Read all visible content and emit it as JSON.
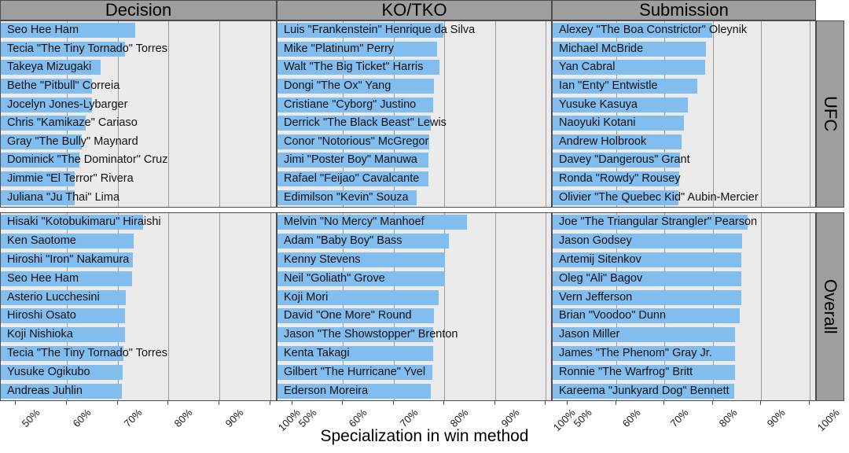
{
  "axis_title": "Specialization in win method",
  "colors": {
    "bar": "#82bdef",
    "panel_bg": "#ebebeb",
    "strip_bg": "#9e9e9e",
    "gridline": "#9a9a9a",
    "border": "#4d4d4d"
  },
  "chart_data": {
    "type": "bar",
    "title": "",
    "xlabel": "Specialization in win method",
    "ylabel": "",
    "xlim": [
      50,
      100
    ],
    "xticks": [
      50,
      60,
      70,
      80,
      90,
      100
    ],
    "xticklabels": [
      "50%",
      "60%",
      "70%",
      "80%",
      "90%",
      "100%"
    ],
    "grid": true,
    "orientation": "horizontal",
    "col_facets": [
      "Decision",
      "KO/TKO",
      "Submission"
    ],
    "row_facets": [
      "UFC",
      "Overall"
    ],
    "panels": [
      {
        "col": "Decision",
        "row": "UFC",
        "categories": [
          "Seo Hee Ham",
          "Tecia \"The Tiny Tornado\" Torres",
          "Takeya Mizugaki",
          "Bethe \"Pitbull\" Correia",
          "Jocelyn Jones-Lybarger",
          "Chris \"Kamikaze\" Cariaso",
          "Gray \"The Bully\" Maynard",
          "Dominick \"The Dominator\" Cruz",
          "Jimmie \"El Terror\" Rivera",
          "Juliana \"Ju Thai\" Lima"
        ],
        "values": [
          73.4,
          71.5,
          66.7,
          65.0,
          65.0,
          63.8,
          63.0,
          62.5,
          61.5,
          61.5
        ]
      },
      {
        "col": "KO/TKO",
        "row": "UFC",
        "categories": [
          "Luis \"Frankenstein\" Henrique da Silva",
          "Mike \"Platinum\" Perry",
          "Walt \"The Big Ticket\" Harris",
          "Dongi \"The Ox\" Yang",
          "Cristiane \"Cyborg\" Justino",
          "Derrick \"The Black Beast\" Lewis",
          "Conor \"Notorious\" McGregor",
          "Jimi \"Poster Boy\" Manuwa",
          "Rafael \"Feijao\" Cavalcante",
          "Edimilson \"Kevin\" Souza"
        ],
        "values": [
          79.8,
          78.5,
          79.0,
          78.0,
          77.8,
          77.3,
          77.0,
          76.8,
          76.8,
          74.5
        ]
      },
      {
        "col": "Submission",
        "row": "UFC",
        "categories": [
          "Alexey \"The Boa Constrictor\" Oleynik",
          "Michael McBride",
          "Yan Cabral",
          "Ian \"Enty\" Entwistle",
          "Yusuke Kasuya",
          "Naoyuki Kotani",
          "Andrew Holbrook",
          "Davey \"Dangerous\" Grant",
          "Ronda \"Rowdy\" Rousey",
          "Olivier \"The Quebec Kid\" Aubin-Mercier"
        ],
        "values": [
          79.9,
          78.6,
          78.4,
          76.8,
          74.9,
          74.0,
          73.6,
          73.2,
          73.0,
          72.9
        ]
      },
      {
        "col": "Decision",
        "row": "Overall",
        "categories": [
          "Hisaki \"Kotobukimaru\" Hiraishi",
          "Ken Saotome",
          "Hiroshi \"Iron\" Nakamura",
          "Seo Hee Ham",
          "Asterio Lucchesini",
          "Hiroshi Osato",
          "Koji Nishioka",
          "Tecia \"The Tiny Tornado\" Torres",
          "Yusuke Ogikubo",
          "Andreas Juhlin"
        ],
        "values": [
          75.0,
          73.2,
          73.0,
          72.9,
          71.6,
          71.5,
          71.4,
          71.2,
          71.0,
          70.8
        ]
      },
      {
        "col": "KO/TKO",
        "row": "Overall",
        "categories": [
          "Melvin \"No Mercy\" Manhoef",
          "Adam \"Baby Boy\" Bass",
          "Kenny Stevens",
          "Neil \"Goliath\" Grove",
          "Koji Mori",
          "David \"One More\" Round",
          "Jason \"The Showstopper\" Brenton",
          "Kenta Takagi",
          "Gilbert \"The Hurricane\" Yvel",
          "Ederson Moreira"
        ],
        "values": [
          84.4,
          80.9,
          80.1,
          80.2,
          78.9,
          77.9,
          77.8,
          77.8,
          77.6,
          77.4
        ]
      },
      {
        "col": "Submission",
        "row": "Overall",
        "categories": [
          "Joe \"The Triangular Strangler\" Pearson",
          "Jason Godsey",
          "Artemij Sitenkov",
          "Oleg \"Ali\" Bagov",
          "Vern Jefferson",
          "Brian \"Voodoo\" Dunn",
          "Jason  Miller",
          "James \"The Phenom\" Gray Jr.",
          "Ronnie \"The Warfrog\" Britt",
          "Kareema \"Junkyard Dog\" Bennett"
        ],
        "values": [
          87.1,
          86.0,
          85.9,
          85.8,
          85.8,
          85.5,
          84.6,
          84.5,
          84.5,
          84.4
        ]
      }
    ]
  }
}
